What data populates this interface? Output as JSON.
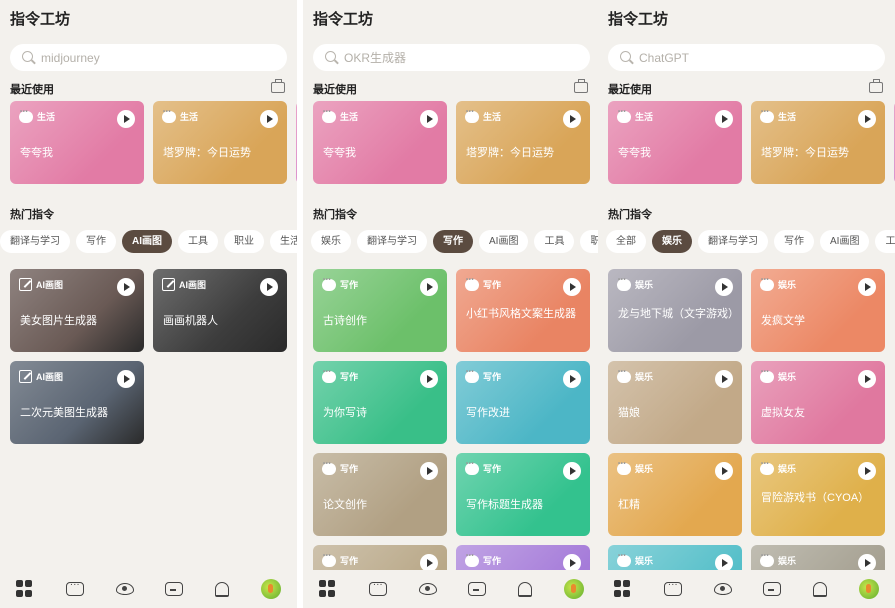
{
  "panels": [
    {
      "title": "指令工坊",
      "search": {
        "value": "",
        "placeholder": "midjourney"
      },
      "recent_title": "最近使用",
      "recent": [
        {
          "tag": "生活",
          "title": "夸夸我",
          "color": "#e27ba5"
        },
        {
          "tag": "生活",
          "title": "塔罗牌：今日运势",
          "color": "#d9a558"
        }
      ],
      "hot_title": "热门指令",
      "tabs": [
        "翻译与学习",
        "写作",
        "AI画图",
        "工具",
        "职业",
        "生活"
      ],
      "active_tab": "AI画图",
      "cards": [
        {
          "tag": "AI画图",
          "title": "美女图片生成器",
          "color": "#6a5a55"
        },
        {
          "tag": "AI画图",
          "title": "画画机器人",
          "color": "#3d3d3d"
        },
        {
          "tag": "AI画图",
          "title": "二次元美图生成器",
          "color": "#5a6472"
        }
      ]
    },
    {
      "title": "指令工坊",
      "search": {
        "value": "",
        "placeholder": "OKR生成器"
      },
      "recent_title": "最近使用",
      "recent": [
        {
          "tag": "生活",
          "title": "夸夸我",
          "color": "#e27ba5"
        },
        {
          "tag": "生活",
          "title": "塔罗牌：今日运势",
          "color": "#d9a558"
        }
      ],
      "hot_title": "热门指令",
      "tabs": [
        "娱乐",
        "翻译与学习",
        "写作",
        "AI画图",
        "工具",
        "职"
      ],
      "active_tab": "写作",
      "cards": [
        {
          "tag": "写作",
          "title": "古诗创作",
          "color": "#6cc06a"
        },
        {
          "tag": "写作",
          "title": "小红书风格文案生成器",
          "color": "#e98463"
        },
        {
          "tag": "写作",
          "title": "为你写诗",
          "color": "#39bf88"
        },
        {
          "tag": "写作",
          "title": "写作改进",
          "color": "#4cb6c6"
        },
        {
          "tag": "写作",
          "title": "论文创作",
          "color": "#b1a083"
        },
        {
          "tag": "写作",
          "title": "写作标题生成器",
          "color": "#33c28e"
        },
        {
          "tag": "写作",
          "title": "",
          "color": "#b9a888"
        },
        {
          "tag": "写作",
          "title": "",
          "color": "#a57bd9"
        }
      ]
    },
    {
      "title": "指令工坊",
      "search": {
        "value": "",
        "placeholder": "ChatGPT"
      },
      "recent_title": "最近使用",
      "recent": [
        {
          "tag": "生活",
          "title": "夸夸我",
          "color": "#e27ba5"
        },
        {
          "tag": "生活",
          "title": "塔罗牌：今日运势",
          "color": "#d9a558"
        }
      ],
      "hot_title": "热门指令",
      "tabs": [
        "全部",
        "娱乐",
        "翻译与学习",
        "写作",
        "AI画图",
        "工"
      ],
      "active_tab": "娱乐",
      "cards": [
        {
          "tag": "娱乐",
          "title": "龙与地下城（文字游戏）",
          "color": "#9c9aa6"
        },
        {
          "tag": "娱乐",
          "title": "发疯文学",
          "color": "#ec8865"
        },
        {
          "tag": "娱乐",
          "title": "猫娘",
          "color": "#c2a988"
        },
        {
          "tag": "娱乐",
          "title": "虚拟女友",
          "color": "#e0789f"
        },
        {
          "tag": "娱乐",
          "title": "杠精",
          "color": "#e3a84f"
        },
        {
          "tag": "娱乐",
          "title": "冒险游戏书（CYOA）",
          "color": "#dfb04a"
        },
        {
          "tag": "娱乐",
          "title": "",
          "color": "#55bfc9"
        },
        {
          "tag": "娱乐",
          "title": "",
          "color": "#a5a091"
        }
      ]
    }
  ],
  "nav": [
    "home-icon",
    "message-icon",
    "eye-icon",
    "bot-icon",
    "bell-icon",
    "avatar"
  ]
}
